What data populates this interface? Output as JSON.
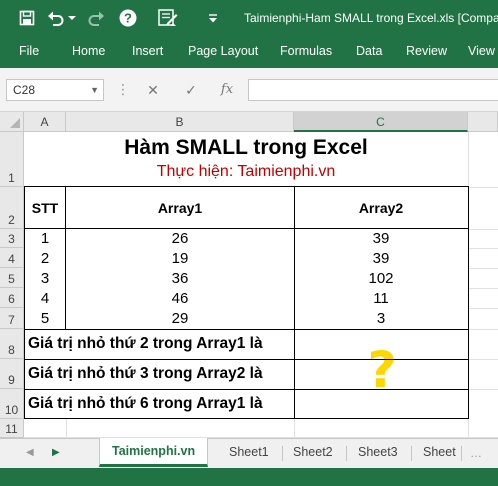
{
  "app": {
    "window_title": "Taimienphi-Ham SMALL trong Excel.xls  [Compa",
    "accent_color": "#217346"
  },
  "quick_access": [
    {
      "name": "save-icon"
    },
    {
      "name": "undo-icon"
    },
    {
      "name": "undo-dropdown-icon"
    },
    {
      "name": "redo-icon"
    },
    {
      "name": "help-icon"
    },
    {
      "name": "form-icon"
    },
    {
      "name": "customize-icon"
    }
  ],
  "ribbon": {
    "tabs": [
      "File",
      "Home",
      "Insert",
      "Page Layout",
      "Formulas",
      "Data",
      "Review",
      "View"
    ]
  },
  "formula_bar": {
    "name_box": "C28",
    "cancel_icon": "✕",
    "confirm_icon": "✓",
    "fx_label": "fx",
    "formula": ""
  },
  "columns": [
    "A",
    "B",
    "C"
  ],
  "selected_column": "C",
  "rows": [
    "1",
    "2",
    "3",
    "4",
    "5",
    "6",
    "7",
    "8",
    "9",
    "10",
    "11"
  ],
  "sheet": {
    "title": "Hàm SMALL trong Excel",
    "subtitle": "Thực hiện: Taimienphi.vn",
    "headers": {
      "stt": "STT",
      "array1": "Array1",
      "array2": "Array2"
    },
    "data_rows": [
      {
        "stt": "1",
        "array1": "26",
        "array2": "39"
      },
      {
        "stt": "2",
        "array1": "19",
        "array2": "39"
      },
      {
        "stt": "3",
        "array1": "36",
        "array2": "102"
      },
      {
        "stt": "4",
        "array1": "46",
        "array2": "11"
      },
      {
        "stt": "5",
        "array1": "29",
        "array2": "3"
      }
    ],
    "questions": [
      "Giá trị nhỏ thứ 2 trong Array1 là",
      "Giá trị nhỏ thứ 3 trong Array2 là",
      "Giá trị nhỏ thứ 6 trong Array1 là"
    ],
    "answer_placeholder": "?"
  },
  "sheet_tabs": {
    "tabs": [
      "Taimienphi.vn",
      "Sheet1",
      "Sheet2",
      "Sheet3",
      "Sheet"
    ],
    "active": "Taimienphi.vn"
  }
}
